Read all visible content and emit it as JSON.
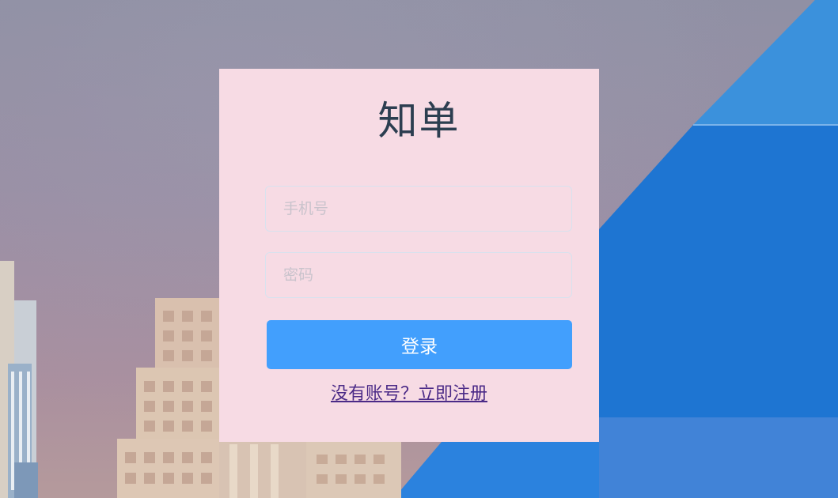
{
  "app": {
    "brand_title": "知单"
  },
  "login_form": {
    "phone_placeholder": "手机号",
    "password_placeholder": "密码",
    "phone_value": "",
    "password_value": "",
    "submit_label": "登录",
    "register_link_text": "没有账号？立即注册"
  },
  "colors": {
    "card_background": "#f7dbe4",
    "button_background": "#429ffd",
    "title_color": "#2c3e50",
    "link_color": "#4b2a87",
    "accent_blue": "#1f78d6"
  }
}
